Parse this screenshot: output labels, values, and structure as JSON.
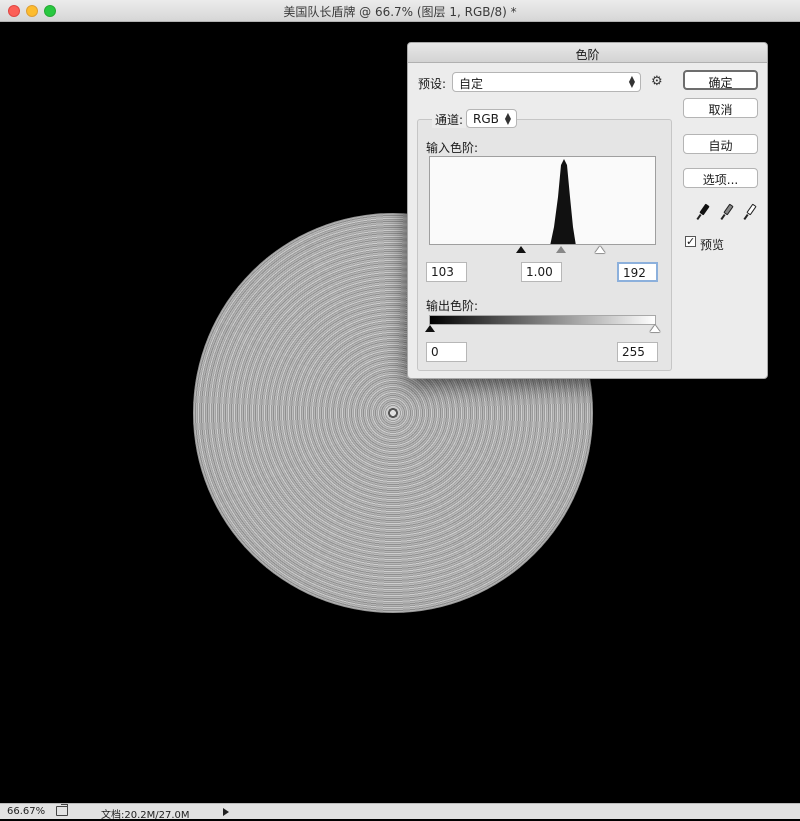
{
  "window": {
    "title": "美国队长盾牌 @ 66.7% (图层 1, RGB/8) *"
  },
  "status_bar": {
    "zoom": "66.67%",
    "doc_info": "文档:20.2M/27.0M"
  },
  "levels_dialog": {
    "title": "色阶",
    "preset_label": "预设:",
    "preset_value": "自定",
    "channel_label": "通道:",
    "channel_value": "RGB",
    "input_levels_label": "输入色阶:",
    "input_black": "103",
    "input_gamma": "1.00",
    "input_white": "192",
    "output_levels_label": "输出色阶:",
    "output_black": "0",
    "output_white": "255",
    "buttons": {
      "ok": "确定",
      "cancel": "取消",
      "auto": "自动",
      "options": "选项..."
    },
    "preview_label": "预览",
    "preview_checked": true
  },
  "icons": {
    "gear": "gear-icon",
    "black_point": "black-eyedropper-icon",
    "gray_point": "gray-eyedropper-icon",
    "white_point": "white-eyedropper-icon",
    "export": "export-icon"
  },
  "colors": {
    "close": "#fc5f57",
    "minimize": "#fdbc2e",
    "maximize": "#28c840",
    "canvas": "#000000",
    "dialog_bg": "#ececec"
  }
}
